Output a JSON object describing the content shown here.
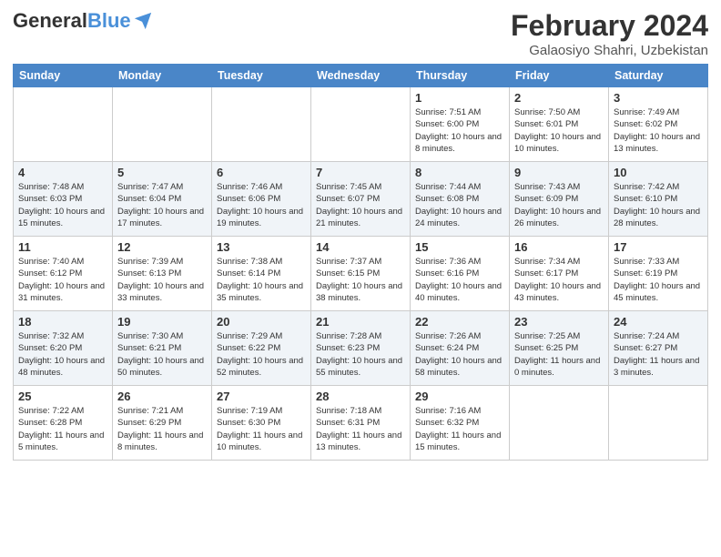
{
  "header": {
    "logo_general": "General",
    "logo_blue": "Blue",
    "title": "February 2024",
    "subtitle": "Galaosiyo Shahri, Uzbekistan"
  },
  "days_of_week": [
    "Sunday",
    "Monday",
    "Tuesday",
    "Wednesday",
    "Thursday",
    "Friday",
    "Saturday"
  ],
  "weeks": [
    [
      {
        "day": "",
        "info": ""
      },
      {
        "day": "",
        "info": ""
      },
      {
        "day": "",
        "info": ""
      },
      {
        "day": "",
        "info": ""
      },
      {
        "day": "1",
        "info": "Sunrise: 7:51 AM\nSunset: 6:00 PM\nDaylight: 10 hours\nand 8 minutes."
      },
      {
        "day": "2",
        "info": "Sunrise: 7:50 AM\nSunset: 6:01 PM\nDaylight: 10 hours\nand 10 minutes."
      },
      {
        "day": "3",
        "info": "Sunrise: 7:49 AM\nSunset: 6:02 PM\nDaylight: 10 hours\nand 13 minutes."
      }
    ],
    [
      {
        "day": "4",
        "info": "Sunrise: 7:48 AM\nSunset: 6:03 PM\nDaylight: 10 hours\nand 15 minutes."
      },
      {
        "day": "5",
        "info": "Sunrise: 7:47 AM\nSunset: 6:04 PM\nDaylight: 10 hours\nand 17 minutes."
      },
      {
        "day": "6",
        "info": "Sunrise: 7:46 AM\nSunset: 6:06 PM\nDaylight: 10 hours\nand 19 minutes."
      },
      {
        "day": "7",
        "info": "Sunrise: 7:45 AM\nSunset: 6:07 PM\nDaylight: 10 hours\nand 21 minutes."
      },
      {
        "day": "8",
        "info": "Sunrise: 7:44 AM\nSunset: 6:08 PM\nDaylight: 10 hours\nand 24 minutes."
      },
      {
        "day": "9",
        "info": "Sunrise: 7:43 AM\nSunset: 6:09 PM\nDaylight: 10 hours\nand 26 minutes."
      },
      {
        "day": "10",
        "info": "Sunrise: 7:42 AM\nSunset: 6:10 PM\nDaylight: 10 hours\nand 28 minutes."
      }
    ],
    [
      {
        "day": "11",
        "info": "Sunrise: 7:40 AM\nSunset: 6:12 PM\nDaylight: 10 hours\nand 31 minutes."
      },
      {
        "day": "12",
        "info": "Sunrise: 7:39 AM\nSunset: 6:13 PM\nDaylight: 10 hours\nand 33 minutes."
      },
      {
        "day": "13",
        "info": "Sunrise: 7:38 AM\nSunset: 6:14 PM\nDaylight: 10 hours\nand 35 minutes."
      },
      {
        "day": "14",
        "info": "Sunrise: 7:37 AM\nSunset: 6:15 PM\nDaylight: 10 hours\nand 38 minutes."
      },
      {
        "day": "15",
        "info": "Sunrise: 7:36 AM\nSunset: 6:16 PM\nDaylight: 10 hours\nand 40 minutes."
      },
      {
        "day": "16",
        "info": "Sunrise: 7:34 AM\nSunset: 6:17 PM\nDaylight: 10 hours\nand 43 minutes."
      },
      {
        "day": "17",
        "info": "Sunrise: 7:33 AM\nSunset: 6:19 PM\nDaylight: 10 hours\nand 45 minutes."
      }
    ],
    [
      {
        "day": "18",
        "info": "Sunrise: 7:32 AM\nSunset: 6:20 PM\nDaylight: 10 hours\nand 48 minutes."
      },
      {
        "day": "19",
        "info": "Sunrise: 7:30 AM\nSunset: 6:21 PM\nDaylight: 10 hours\nand 50 minutes."
      },
      {
        "day": "20",
        "info": "Sunrise: 7:29 AM\nSunset: 6:22 PM\nDaylight: 10 hours\nand 52 minutes."
      },
      {
        "day": "21",
        "info": "Sunrise: 7:28 AM\nSunset: 6:23 PM\nDaylight: 10 hours\nand 55 minutes."
      },
      {
        "day": "22",
        "info": "Sunrise: 7:26 AM\nSunset: 6:24 PM\nDaylight: 10 hours\nand 58 minutes."
      },
      {
        "day": "23",
        "info": "Sunrise: 7:25 AM\nSunset: 6:25 PM\nDaylight: 11 hours\nand 0 minutes."
      },
      {
        "day": "24",
        "info": "Sunrise: 7:24 AM\nSunset: 6:27 PM\nDaylight: 11 hours\nand 3 minutes."
      }
    ],
    [
      {
        "day": "25",
        "info": "Sunrise: 7:22 AM\nSunset: 6:28 PM\nDaylight: 11 hours\nand 5 minutes."
      },
      {
        "day": "26",
        "info": "Sunrise: 7:21 AM\nSunset: 6:29 PM\nDaylight: 11 hours\nand 8 minutes."
      },
      {
        "day": "27",
        "info": "Sunrise: 7:19 AM\nSunset: 6:30 PM\nDaylight: 11 hours\nand 10 minutes."
      },
      {
        "day": "28",
        "info": "Sunrise: 7:18 AM\nSunset: 6:31 PM\nDaylight: 11 hours\nand 13 minutes."
      },
      {
        "day": "29",
        "info": "Sunrise: 7:16 AM\nSunset: 6:32 PM\nDaylight: 11 hours\nand 15 minutes."
      },
      {
        "day": "",
        "info": ""
      },
      {
        "day": "",
        "info": ""
      }
    ]
  ]
}
